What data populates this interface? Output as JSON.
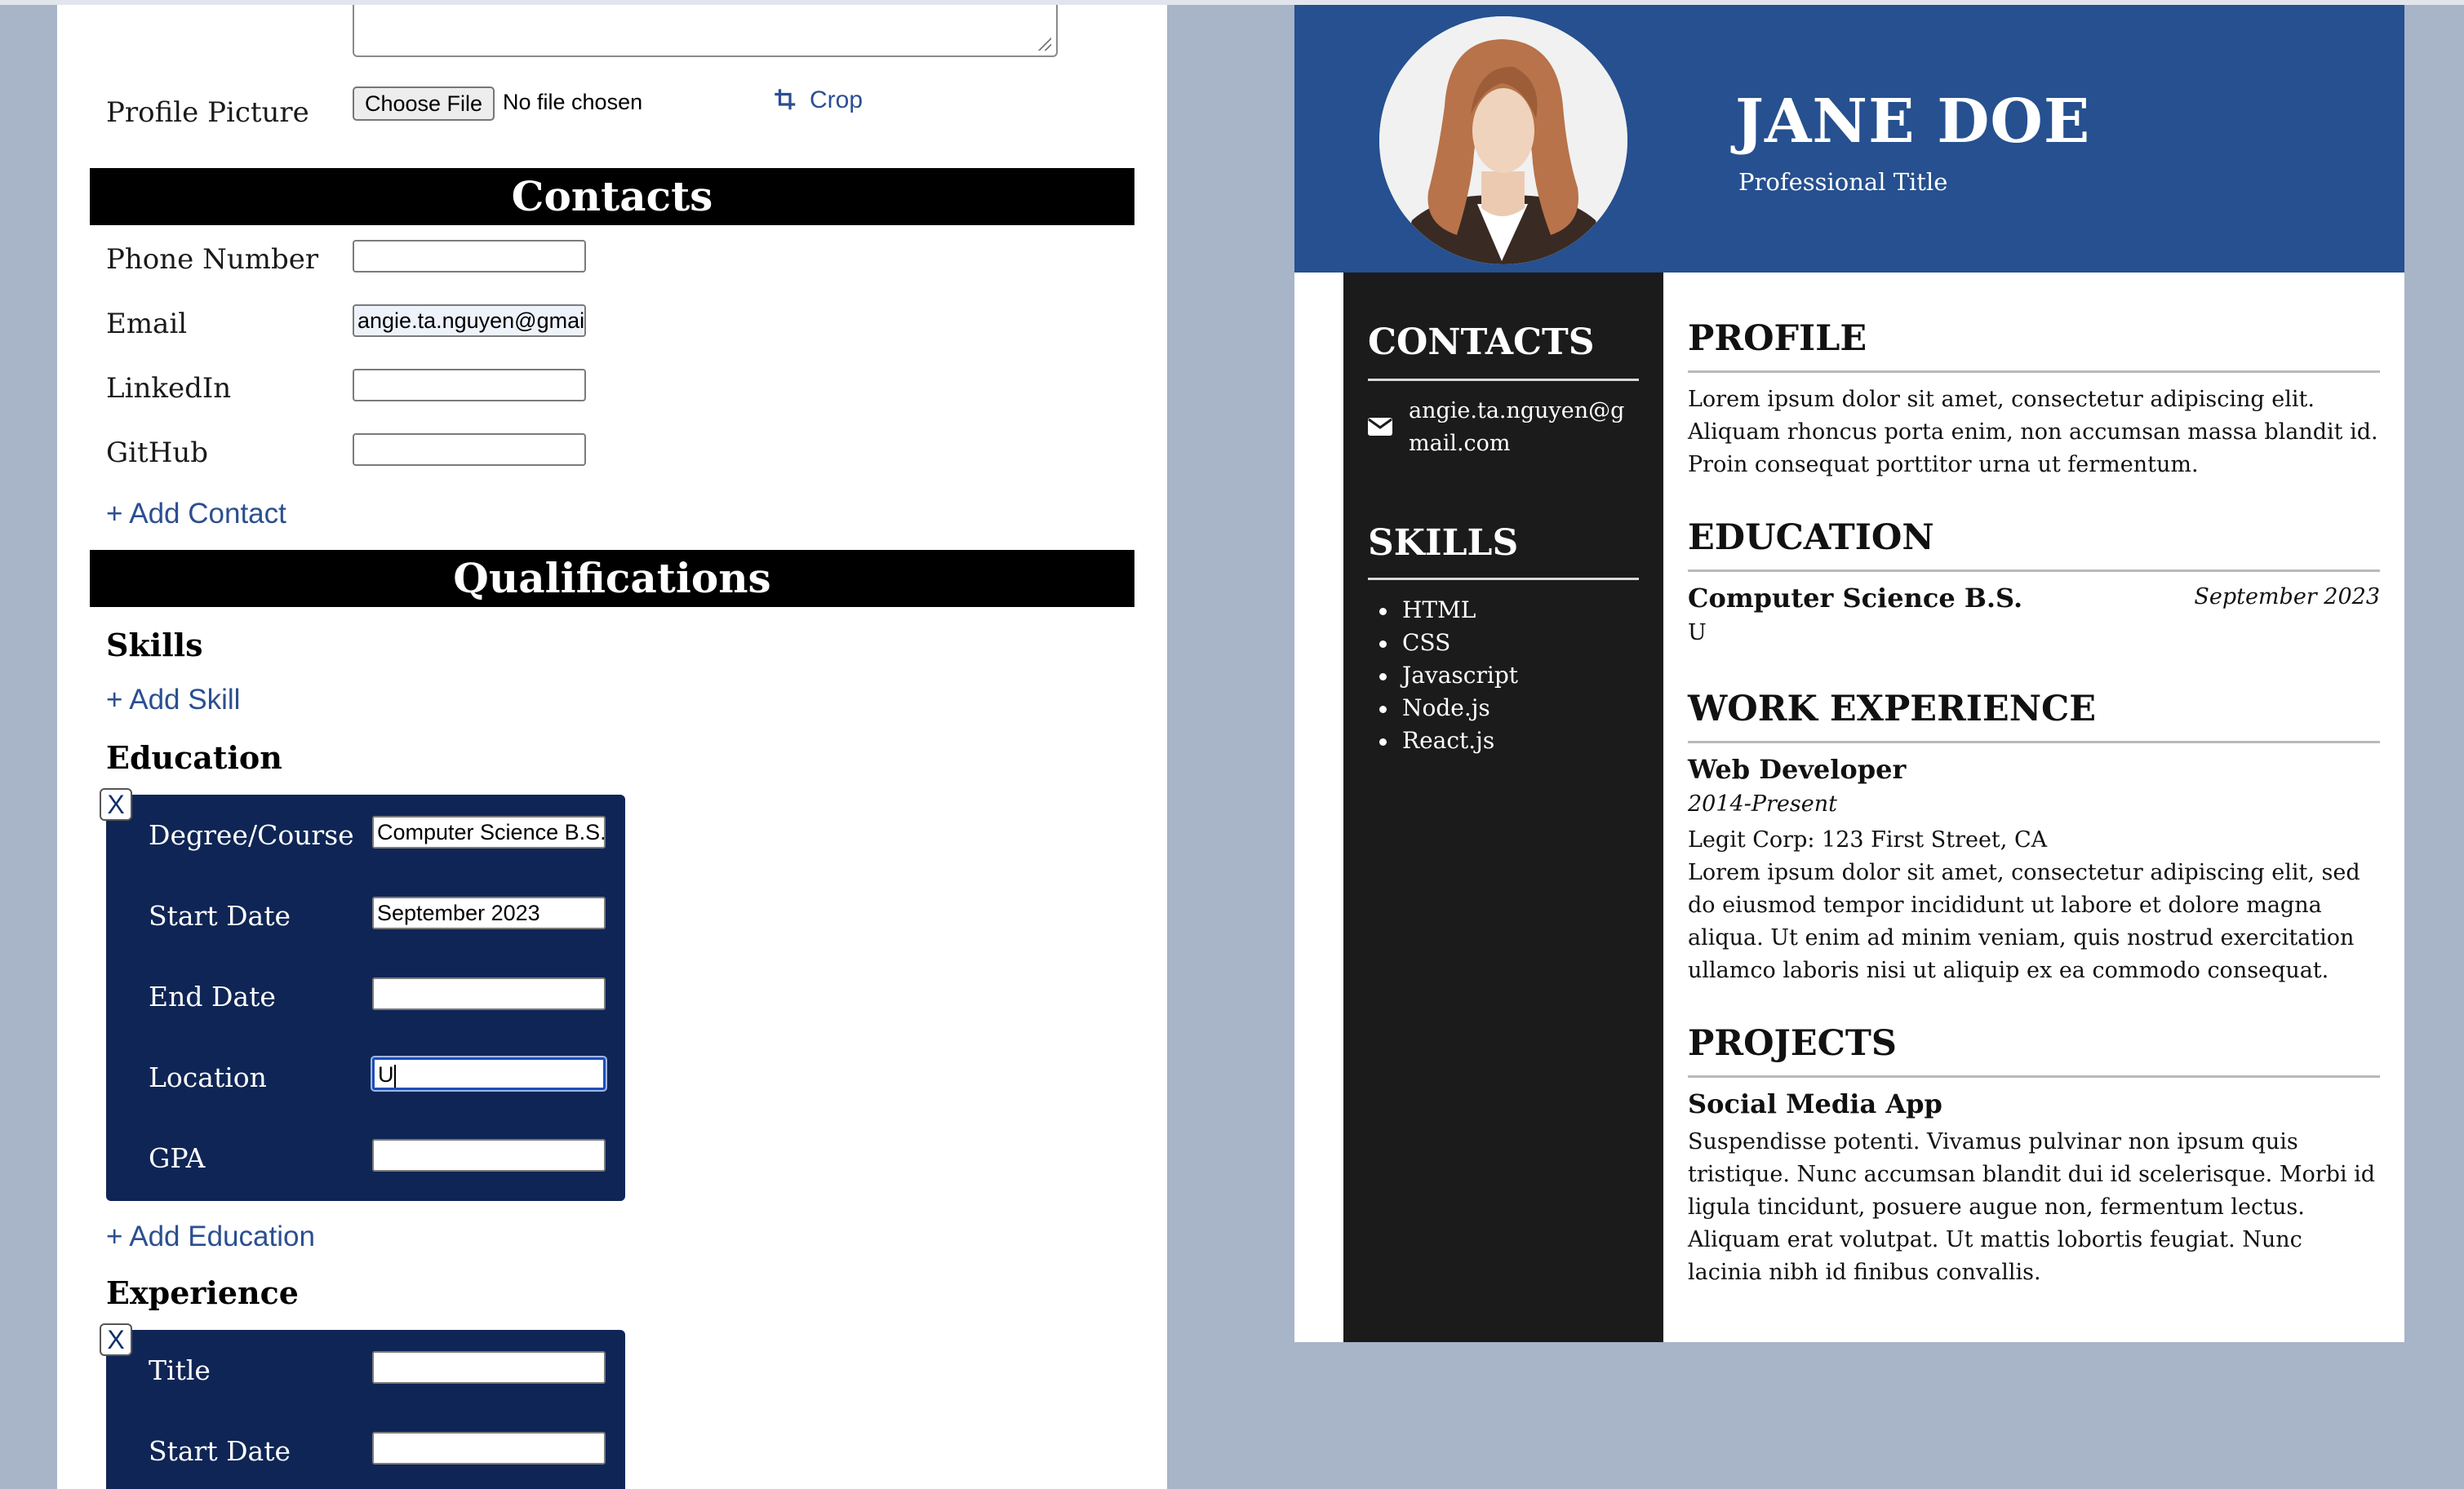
{
  "form": {
    "profile_picture_label": "Profile Picture",
    "choose_file_label": "Choose File",
    "file_status": "No file chosen",
    "crop_label": "Crop",
    "contacts_heading": "Contacts",
    "contacts": [
      {
        "label": "Phone Number",
        "value": ""
      },
      {
        "label": "Email",
        "value": "angie.ta.nguyen@gmail"
      },
      {
        "label": "LinkedIn",
        "value": ""
      },
      {
        "label": "GitHub",
        "value": ""
      }
    ],
    "add_contact_label": "+ Add Contact",
    "qualifications_heading": "Qualifications",
    "skills_heading": "Skills",
    "add_skill_label": "+ Add Skill",
    "education_heading": "Education",
    "education_card": {
      "remove_label": "X",
      "fields": [
        {
          "label": "Degree/Course",
          "value": "Computer Science B.S."
        },
        {
          "label": "Start Date",
          "value": "September 2023"
        },
        {
          "label": "End Date",
          "value": ""
        },
        {
          "label": "Location",
          "value": "U"
        },
        {
          "label": "GPA",
          "value": ""
        }
      ]
    },
    "add_education_label": "+ Add Education",
    "experience_heading": "Experience",
    "experience_card": {
      "remove_label": "X",
      "fields": [
        {
          "label": "Title",
          "value": ""
        },
        {
          "label": "Start Date",
          "value": ""
        }
      ]
    }
  },
  "resume": {
    "name": "JANE DOE",
    "title": "Professional Title",
    "contacts_heading": "CONTACTS",
    "email": "angie.ta.nguyen@gmail.com",
    "skills_heading": "SKILLS",
    "skills": [
      "HTML",
      "CSS",
      "Javascript",
      "Node.js",
      "React.js"
    ],
    "profile_heading": "PROFILE",
    "profile_text": "Lorem ipsum dolor sit amet, consectetur adipiscing elit. Aliquam rhoncus porta enim, non accumsan massa blandit id. Proin consequat porttitor urna ut fermentum.",
    "education_heading": "EDUCATION",
    "education": {
      "degree": "Computer Science B.S.",
      "date": "September 2023",
      "location": "U"
    },
    "work_heading": "WORK EXPERIENCE",
    "work": {
      "title": "Web Developer",
      "dates": "2014-Present",
      "company": "Legit Corp: 123 First Street, CA",
      "description": "Lorem ipsum dolor sit amet, consectetur adipiscing elit, sed do eiusmod tempor incididunt ut labore et dolore magna aliqua. Ut enim ad minim veniam, quis nostrud exercitation ullamco laboris nisi ut aliquip ex ea commodo consequat."
    },
    "projects_heading": "PROJECTS",
    "project": {
      "name": "Social Media App",
      "description": "Suspendisse potenti. Vivamus pulvinar non ipsum quis tristique. Nunc accumsan blandit dui id scelerisque. Morbi id ligula tincidunt, posuere augue non, fermentum lectus. Aliquam erat volutpat. Ut mattis lobortis feugiat. Nunc lacinia nibh id finibus convallis."
    },
    "colors": {
      "header": "#26508f",
      "sidebar": "#1b1b1b",
      "card": "#0f2555",
      "link": "#2b4f90"
    }
  }
}
